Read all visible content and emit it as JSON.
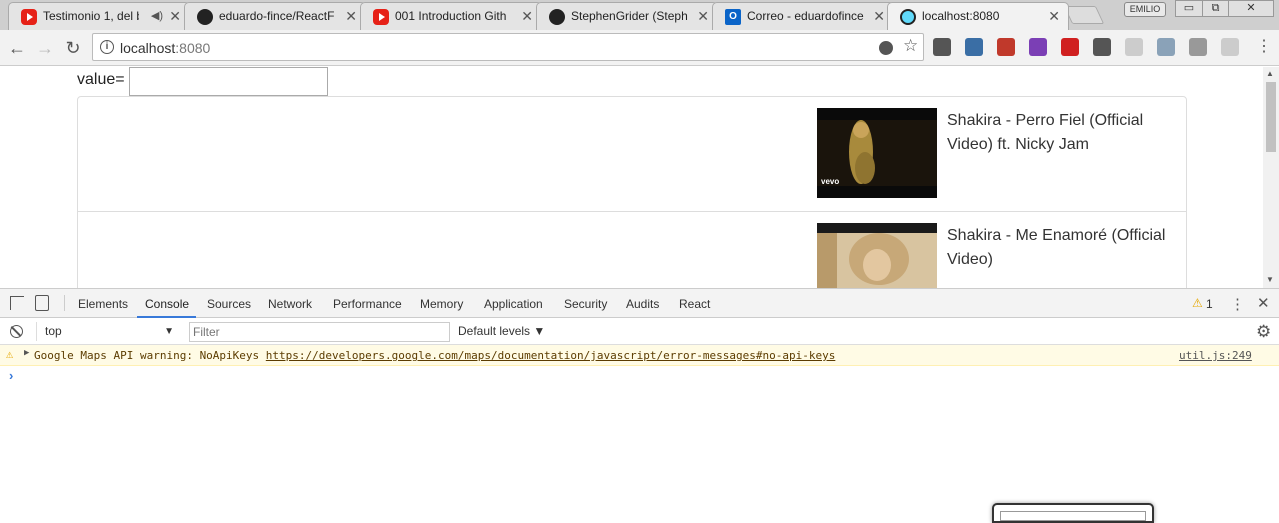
{
  "browser": {
    "tabs": [
      {
        "title": "Testimonio 1, del b",
        "icon": "youtube-icon",
        "audio": true
      },
      {
        "title": "eduardo-fince/ReactF",
        "icon": "github-icon"
      },
      {
        "title": "001 Introduction Gith",
        "icon": "youtube-icon"
      },
      {
        "title": "StephenGrider (Steph",
        "icon": "github-icon"
      },
      {
        "title": "Correo - eduardofince",
        "icon": "outlook-icon"
      },
      {
        "title": "localhost:8080",
        "icon": "react-icon",
        "active": true
      }
    ],
    "profile_label": "EMILIO",
    "tab_close_glyph": "✕",
    "speaker_glyph": "◀)",
    "outlook_glyph": "O",
    "window_buttons": {
      "minimize": "▭",
      "restore": "⧉",
      "close": "✕"
    },
    "nav": {
      "back": "←",
      "forward": "→",
      "reload": "↻"
    },
    "omnibox": {
      "host": "localhost",
      "port": ":8080",
      "info_glyph": "i",
      "star_glyph": "☆"
    },
    "menu_glyph": "⋮",
    "extension_colors": [
      "#555555",
      "#3a6ea5",
      "#c0392b",
      "#7b3fb5",
      "#d02020",
      "#555555",
      "#cccccc",
      "#8aa2b8",
      "#999999",
      "#cccccc"
    ]
  },
  "page": {
    "search_label": "value=",
    "search_value": "",
    "videos": [
      {
        "title": "Shakira - Perro Fiel (Official Video) ft. Nicky Jam",
        "thumb_badge": "vevo"
      },
      {
        "title": "Shakira - Me Enamoré (Official Video)",
        "thumb_badge": ""
      }
    ]
  },
  "devtools": {
    "tabs": [
      "Elements",
      "Console",
      "Sources",
      "Network",
      "Performance",
      "Memory",
      "Application",
      "Security",
      "Audits",
      "React"
    ],
    "active_tab": "Console",
    "warning_count": "1",
    "warning_glyph": "⚠",
    "context": "top",
    "filter_placeholder": "Filter",
    "levels_label": "Default levels ▼",
    "settings_glyph": "⚙",
    "context_arrow": "▼",
    "console": {
      "warning_text": "Google Maps API warning: NoApiKeys ",
      "warning_link": "https://developers.google.com/maps/documentation/javascript/error-messages#no-api-keys",
      "source": "util.js:249",
      "expander": "▶",
      "prompt": "›"
    }
  },
  "colors": {
    "accent": "#3879d9",
    "warning_bg": "#fffbe5",
    "warning_text": "#5c3c00"
  }
}
